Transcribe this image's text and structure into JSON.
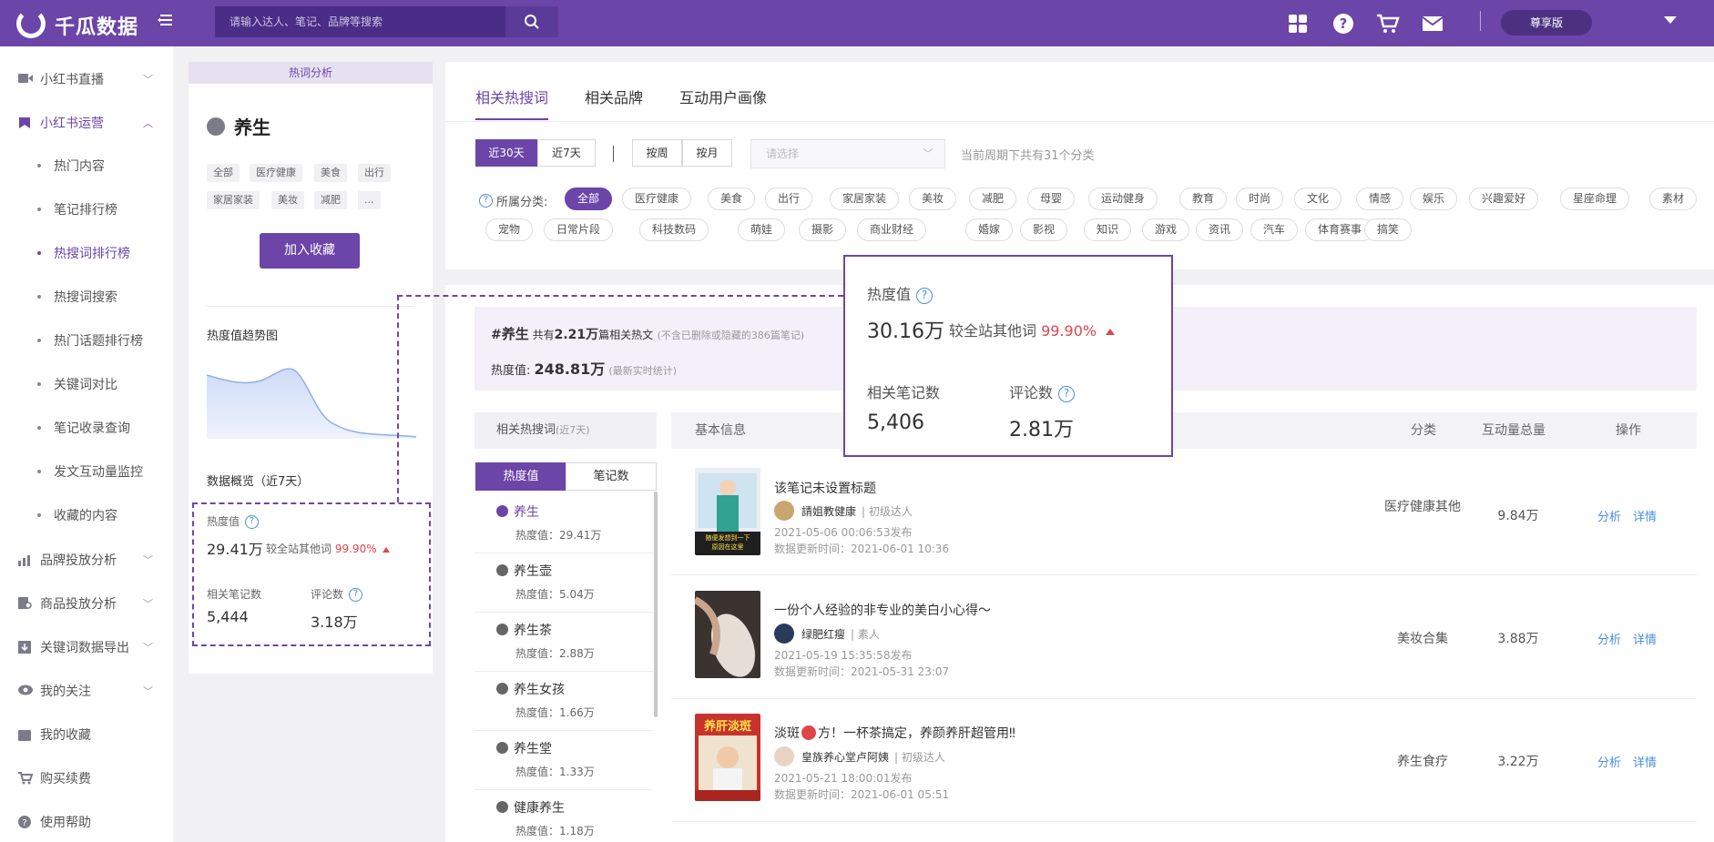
{
  "header": {
    "brand": "千瓜数据",
    "search_placeholder": "请输入达人、笔记、品牌等搜索",
    "vip_label": "尊享版"
  },
  "sidebar": {
    "items": [
      {
        "label": "小红书直播"
      },
      {
        "label": "小红书运营"
      },
      {
        "label": "品牌投放分析"
      },
      {
        "label": "商品投放分析"
      },
      {
        "label": "关键词数据导出"
      },
      {
        "label": "我的关注"
      },
      {
        "label": "我的收藏"
      },
      {
        "label": "购买续费"
      },
      {
        "label": "使用帮助"
      }
    ],
    "subitems": [
      {
        "label": "热门内容"
      },
      {
        "label": "笔记排行榜"
      },
      {
        "label": "热搜词排行榜"
      },
      {
        "label": "热搜词搜索"
      },
      {
        "label": "热门话题排行榜"
      },
      {
        "label": "关键词对比"
      },
      {
        "label": "笔记收录查询"
      },
      {
        "label": "发文互动量监控"
      },
      {
        "label": "收藏的内容"
      }
    ]
  },
  "left_card": {
    "header": "热词分析",
    "keyword": "养生",
    "tags": [
      "全部",
      "医疗健康",
      "美食",
      "出行",
      "家居家装",
      "美妆",
      "减肥",
      "..."
    ],
    "fav_button": "加入收藏",
    "trend_title": "热度值趋势图",
    "overview_title": "数据概览（近7天）",
    "heat_label": "热度值",
    "heat_value": "29.41万",
    "compare_label": "较全站其他词",
    "compare_value": "99.90%",
    "notes_label": "相关笔记数",
    "notes_value": "5,444",
    "comments_label": "评论数",
    "comments_value": "3.18万"
  },
  "tabs": [
    {
      "label": "相关热搜词"
    },
    {
      "label": "相关品牌"
    },
    {
      "label": "互动用户画像"
    }
  ],
  "filters": {
    "range": [
      "近30天",
      "近7天"
    ],
    "period": [
      "按周",
      "按月"
    ],
    "select_placeholder": "请选择",
    "period_note": "当前周期下共有31个分类",
    "category_label": "所属分类:",
    "categories": [
      "全部",
      "医疗健康",
      "美食",
      "出行",
      "家居家装",
      "美妆",
      "减肥",
      "母婴",
      "运动健身",
      "教育",
      "时尚",
      "文化",
      "情感",
      "娱乐",
      "兴趣爱好",
      "星座命理",
      "素材",
      "宠物",
      "日常片段",
      "科技数码",
      "萌娃",
      "摄影",
      "商业财经",
      "婚嫁",
      "影视",
      "知识",
      "游戏",
      "资讯",
      "汽车",
      "体育赛事",
      "搞笑"
    ]
  },
  "infobox": {
    "hash": "#",
    "keyword": "养生",
    "text1": " 共有",
    "count": "2.21万",
    "text2": "篇相关热文",
    "note": "(不含已删除或隐藏的386篇笔记)",
    "heat_label": "热度值:",
    "heat_value": "248.81万",
    "heat_note": "(最新实时统计)"
  },
  "related": {
    "title": "相关热搜词",
    "title_note": "(近7天)",
    "seg": [
      "热度值",
      "笔记数"
    ],
    "items": [
      {
        "name": "养生",
        "heat": "热度值：29.41万"
      },
      {
        "name": "养生壶",
        "heat": "热度值：5.04万"
      },
      {
        "name": "养生茶",
        "heat": "热度值：2.88万"
      },
      {
        "name": "养生女孩",
        "heat": "热度值：1.66万"
      },
      {
        "name": "养生堂",
        "heat": "热度值：1.33万"
      },
      {
        "name": "健康养生",
        "heat": "热度值：1.18万"
      }
    ]
  },
  "table": {
    "headers": {
      "info": "基本信息",
      "category": "分类",
      "interaction": "互动量总量",
      "action": "操作"
    },
    "rows": [
      {
        "title": "该笔记未设置标题",
        "author": "請姐教健康",
        "level": "| 初级达人",
        "published": "2021-05-06 00:06:53发布",
        "updated": "数据更新时间：2021-06-01 10:36",
        "category": "医疗健康其他",
        "interaction": "9.84万",
        "analyze": "分析",
        "detail": "详情",
        "thumb_text": "随便发想到一下\n原因在这里"
      },
      {
        "title": "一份个人经验的非专业的美白小心得～",
        "author": "绿肥红瘦",
        "level": "| 素人",
        "published": "2021-05-19 15:35:58发布",
        "updated": "数据更新时间：2021-05-31 23:07",
        "category": "美妆合集",
        "interaction": "3.88万",
        "analyze": "分析",
        "detail": "详情"
      },
      {
        "title": "淡斑",
        "title_tail": "方！一杯茶搞定，养颜养肝超管用‼",
        "author": "皇族养心堂卢阿姨",
        "level": "| 初级达人",
        "published": "2021-05-21 18:00:01发布",
        "updated": "数据更新时间：2021-06-01 05:51",
        "category": "养生食疗",
        "interaction": "3.22万",
        "analyze": "分析",
        "detail": "详情",
        "thumb_text": "养肝淡斑"
      }
    ]
  },
  "popup": {
    "heat_label": "热度值",
    "heat_value": "30.16万",
    "compare_label": "较全站其他词",
    "compare_value": "99.90%",
    "notes_label": "相关笔记数",
    "notes_value": "5,406",
    "comments_label": "评论数",
    "comments_value": "2.81万"
  },
  "colors": {
    "brand": "#6c45a8",
    "accent_red": "#e0454a",
    "link": "#4a8fe2"
  }
}
